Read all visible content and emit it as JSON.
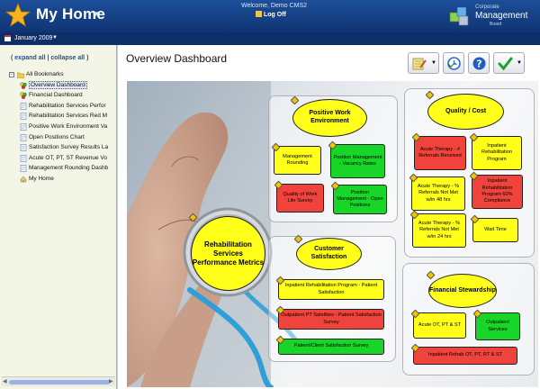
{
  "header": {
    "app_title": "My Home",
    "welcome": "Welcome, Demo CMS2",
    "log_off": "Log Off",
    "brand_top": "Corporate",
    "brand_main": "Management",
    "brand_sub": "Board"
  },
  "date_bar": {
    "label": "January 2009"
  },
  "sidebar": {
    "expand_all": "expand all",
    "separator": "|",
    "collapse_all": "collapse all",
    "root_label": "All Bookmarks",
    "items": [
      {
        "label": "Overview Dashboard",
        "icon": "dashboard-icon",
        "selected": true
      },
      {
        "label": "Financial Dashboard",
        "icon": "dashboard-icon"
      },
      {
        "label": "Rehabilitation Services Perfor",
        "icon": "report-icon"
      },
      {
        "label": "Rehabilitation Services Red M",
        "icon": "report-icon"
      },
      {
        "label": "Positive Work Environment Va",
        "icon": "report-icon"
      },
      {
        "label": "Open Positions Chart",
        "icon": "report-icon"
      },
      {
        "label": "Satisfaction Survey Results La",
        "icon": "report-icon"
      },
      {
        "label": "Acute OT, PT, ST Revenue Vo",
        "icon": "report-icon"
      },
      {
        "label": "Management Rounding Dashb",
        "icon": "report-icon"
      },
      {
        "label": "My Home",
        "icon": "home-icon"
      }
    ]
  },
  "main": {
    "title": "Overview Dashboard"
  },
  "dashboard": {
    "center": "Rehabilitation Services Performance Metrics",
    "panels": [
      {
        "title": "Positive Work Environment",
        "boxes": [
          {
            "label": "Management Rounding",
            "status": "yellow"
          },
          {
            "label": "Position Management - Vacancy Rates",
            "status": "green"
          },
          {
            "label": "Quality of Work Life Survey",
            "status": "red"
          },
          {
            "label": "Position Management - Open Positions",
            "status": "green"
          }
        ]
      },
      {
        "title": "Quality / Cost",
        "boxes": [
          {
            "label": "Acute Therapy - # Referrals Received",
            "status": "red"
          },
          {
            "label": "Inpatient Rehabilitation Program",
            "status": "yellow"
          },
          {
            "label": "Acute Therapy - % Referrals Not Met w/in 48 hrs",
            "status": "yellow"
          },
          {
            "label": "Inpatient Rehabilitation Program 60% Compliance",
            "status": "red"
          },
          {
            "label": "Acute Therapy - % Referrals Not Met w/in 24 hrs",
            "status": "yellow"
          },
          {
            "label": "Wait Time",
            "status": "yellow"
          }
        ]
      },
      {
        "title": "Customer Satisfaction",
        "boxes": [
          {
            "label": "Inpatient Rehabilitation Program - Patient Satisfaction",
            "status": "yellow"
          },
          {
            "label": "Outpatient PT Satellites - Patient Satisfaction Survey",
            "status": "red"
          },
          {
            "label": "Patient/Client Satisfaction Survey",
            "status": "green"
          }
        ]
      },
      {
        "title": "Financial Stewardship",
        "boxes": [
          {
            "label": "Acute OT, PT & ST",
            "status": "yellow"
          },
          {
            "label": "Outpatient Services",
            "status": "green"
          },
          {
            "label": "Inpatient Rehab OT, PT, RT & ST",
            "status": "red"
          }
        ]
      }
    ]
  },
  "colors": {
    "yellow": "#ffff1a",
    "green": "#18d628",
    "red": "#f0433c",
    "header": "#1c4f9a"
  }
}
